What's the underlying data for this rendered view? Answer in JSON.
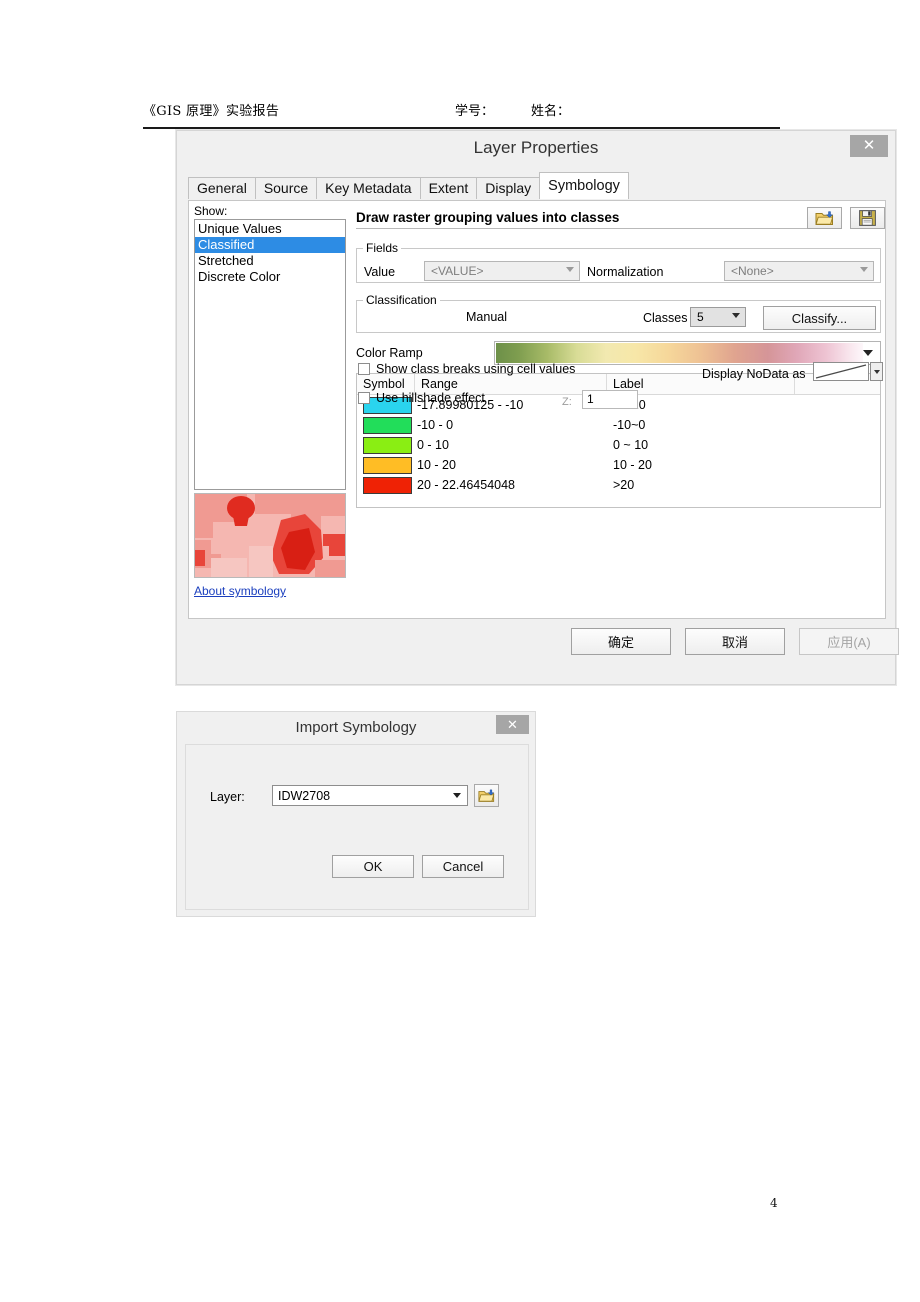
{
  "document_header": {
    "title": "《GIS 原理》实验报告",
    "student_id_label": "学号：",
    "name_label": "姓名：",
    "page_number": "4"
  },
  "layer_properties": {
    "window_title": "Layer Properties",
    "close_glyph": "✕",
    "tabs": [
      {
        "label": "General",
        "active": false
      },
      {
        "label": "Source",
        "active": false
      },
      {
        "label": "Key Metadata",
        "active": false
      },
      {
        "label": "Extent",
        "active": false
      },
      {
        "label": "Display",
        "active": false
      },
      {
        "label": "Symbology",
        "active": true
      }
    ],
    "show": {
      "label": "Show:",
      "items": [
        "Unique Values",
        "Classified",
        "Stretched",
        "Discrete Color"
      ],
      "selected": "Classified"
    },
    "about_link": "About symbology",
    "draw_heading": "Draw raster grouping values into classes",
    "toolbar": {
      "import_icon": "folder-import-icon",
      "save_icon": "floppy-save-icon"
    },
    "fields": {
      "legend": "Fields",
      "value_label": "Value",
      "value": "<VALUE>",
      "normalization_label": "Normalization",
      "normalization": "<None>"
    },
    "classification": {
      "legend": "Classification",
      "method": "Manual",
      "classes_label": "Classes",
      "classes": "5",
      "classify_button": "Classify..."
    },
    "color_ramp": {
      "label": "Color Ramp",
      "stops": [
        "#6d9049",
        "#a8bb68",
        "#d8dc96",
        "#f2e9b0",
        "#f6d79a",
        "#e0a48f",
        "#d59598",
        "#eec4d3",
        "#fdf7fa"
      ]
    },
    "symbol_table": {
      "columns": [
        "Symbol",
        "Range",
        "Label",
        ""
      ],
      "rows": [
        {
          "color": "#2ad4ee",
          "range": "-17.89980125 - -10",
          "label": "<=-10"
        },
        {
          "color": "#22dd5a",
          "range": "-10 - 0",
          "label": "-10~0"
        },
        {
          "color": "#8aee13",
          "range": "0 - 10",
          "label": "0 ~ 10"
        },
        {
          "color": "#ffbd25",
          "range": "10 - 20",
          "label": "10 - 20"
        },
        {
          "color": "#ef2205",
          "range": "20 - 22.46454048",
          "label": ">20"
        }
      ]
    },
    "options": {
      "show_class_breaks": "Show class breaks using cell values",
      "show_class_breaks_checked": false,
      "use_hillshade": "Use hillshade effect",
      "use_hillshade_checked": false,
      "z_label": "Z:",
      "z_value": "1",
      "display_nodata_label": "Display NoData as",
      "nodata_swatch": "no-color-diagonal"
    },
    "footer_buttons": [
      {
        "label": "确定",
        "disabled": false
      },
      {
        "label": "取消",
        "disabled": false
      },
      {
        "label": "应用(A)",
        "disabled": true
      }
    ]
  },
  "import_symbology": {
    "window_title": "Import Symbology",
    "close_glyph": "✕",
    "layer_label": "Layer:",
    "layer_value": "IDW2708",
    "browse_icon": "folder-browse-icon",
    "buttons": [
      {
        "label": "OK"
      },
      {
        "label": "Cancel"
      }
    ]
  }
}
